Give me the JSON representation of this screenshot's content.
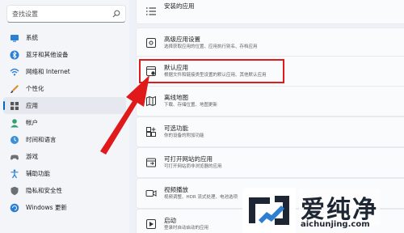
{
  "sidebar": {
    "search_placeholder": "查找设置",
    "items": [
      {
        "label": "系统",
        "icon": "monitor-icon"
      },
      {
        "label": "蓝牙和其他设备",
        "icon": "bluetooth-icon"
      },
      {
        "label": "网络和 Internet",
        "icon": "network-icon"
      },
      {
        "label": "个性化",
        "icon": "brush-icon"
      },
      {
        "label": "应用",
        "icon": "apps-icon"
      },
      {
        "label": "帐户",
        "icon": "user-icon"
      },
      {
        "label": "时间和语言",
        "icon": "globe-clock-icon"
      },
      {
        "label": "游戏",
        "icon": "gamepad-icon"
      },
      {
        "label": "辅助功能",
        "icon": "accessibility-icon"
      },
      {
        "label": "隐私和安全性",
        "icon": "shield-icon"
      },
      {
        "label": "Windows 更新",
        "icon": "update-icon"
      }
    ]
  },
  "main": {
    "cards": [
      {
        "title": "安装的应用",
        "desc": "",
        "icon": "list-icon"
      },
      {
        "title": "高级应用设置",
        "desc": "选择获取应用的位置、应用执行别名、存档应用",
        "icon": "advanced-apps-icon"
      },
      {
        "title": "默认应用",
        "desc": "根据文件和链接类型设置的默认应用、其他默认应用",
        "icon": "default-apps-icon"
      },
      {
        "title": "离线地图",
        "desc": "下载、存储位置、地图更新",
        "icon": "offline-maps-icon"
      },
      {
        "title": "可选功能",
        "desc": "你的设备的附加功能",
        "icon": "optional-features-icon"
      },
      {
        "title": "可打开网站的应用",
        "desc": "可打开网站而非浏览器的应用",
        "icon": "website-apps-icon"
      },
      {
        "title": "视频播放",
        "desc": "视频调整、HDR 流式处理、电池选项",
        "icon": "video-icon"
      },
      {
        "title": "启动",
        "desc": "登录时自动启动的应用",
        "icon": "startup-icon"
      }
    ]
  },
  "watermark": {
    "name": "爱纯净",
    "url": "aichunjing.com"
  },
  "colors": {
    "accent": "#0067c0",
    "highlight": "#e0191b",
    "arrow": "#e0191b"
  }
}
